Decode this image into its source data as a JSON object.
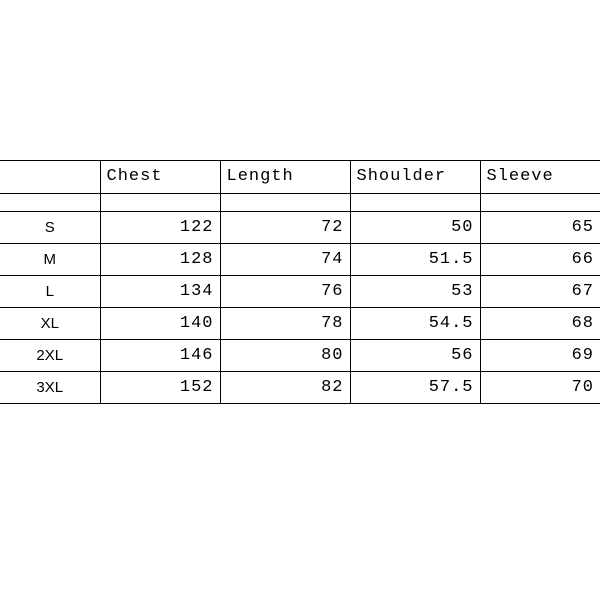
{
  "chart_data": {
    "type": "table",
    "title": "",
    "columns": [
      "",
      "Chest",
      "Length",
      "Shoulder",
      "Sleeve"
    ],
    "rows": [
      {
        "size": "S",
        "chest": 122,
        "length": 72,
        "shoulder": 50,
        "sleeve": 65
      },
      {
        "size": "M",
        "chest": 128,
        "length": 74,
        "shoulder": 51.5,
        "sleeve": 66
      },
      {
        "size": "L",
        "chest": 134,
        "length": 76,
        "shoulder": 53,
        "sleeve": 67
      },
      {
        "size": "XL",
        "chest": 140,
        "length": 78,
        "shoulder": 54.5,
        "sleeve": 68
      },
      {
        "size": "2XL",
        "chest": 146,
        "length": 80,
        "shoulder": 56,
        "sleeve": 69
      },
      {
        "size": "3XL",
        "chest": 152,
        "length": 82,
        "shoulder": 57.5,
        "sleeve": 70
      }
    ]
  }
}
